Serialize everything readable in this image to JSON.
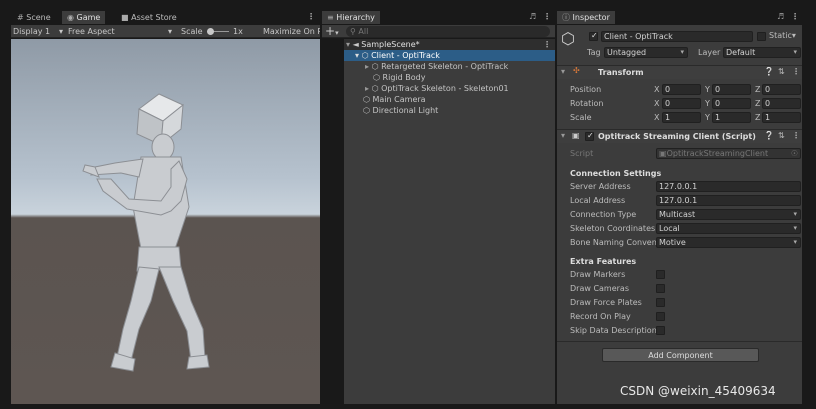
{
  "game": {
    "tabs": [
      {
        "label": "Scene",
        "icon": "hash-icon"
      },
      {
        "label": "Game",
        "icon": "gamepad-icon"
      },
      {
        "label": "Asset Store",
        "icon": "bag-icon"
      }
    ],
    "display": "Display 1",
    "aspect": "Free Aspect",
    "scale_label": "Scale",
    "scale_value": "1x",
    "maximize": "Maximize On P"
  },
  "hierarchy": {
    "title": "Hierarchy",
    "search_placeholder": "All",
    "scene_name": "SampleScene*",
    "items": [
      {
        "label": "Client - OptiTrack",
        "selected": true
      },
      {
        "label": "Retargeted Skeleton - OptiTrack"
      },
      {
        "label": "Rigid Body"
      },
      {
        "label": "OptiTrack Skeleton - Skeleton01"
      },
      {
        "label": "Main Camera"
      },
      {
        "label": "Directional Light"
      }
    ]
  },
  "inspector": {
    "title": "Inspector",
    "object_name": "Client - OptiTrack",
    "static_label": "Static",
    "tag_label": "Tag",
    "tag_value": "Untagged",
    "layer_label": "Layer",
    "layer_value": "Default",
    "transform": {
      "title": "Transform",
      "rows": [
        {
          "label": "Position",
          "x": "0",
          "y": "0",
          "z": "0"
        },
        {
          "label": "Rotation",
          "x": "0",
          "y": "0",
          "z": "0"
        },
        {
          "label": "Scale",
          "x": "1",
          "y": "1",
          "z": "1"
        }
      ],
      "axes": [
        "X",
        "Y",
        "Z"
      ]
    },
    "component": {
      "title": "Optitrack Streaming Client (Script)",
      "script_label": "Script",
      "script_value": "OptitrackStreamingClient",
      "connection_header": "Connection Settings",
      "fields": [
        {
          "label": "Server Address",
          "value": "127.0.0.1"
        },
        {
          "label": "Local Address",
          "value": "127.0.0.1"
        },
        {
          "label": "Connection Type",
          "value": "Multicast"
        },
        {
          "label": "Skeleton Coordinates",
          "value": "Local"
        },
        {
          "label": "Bone Naming Conven",
          "value": "Motive"
        }
      ],
      "extra_header": "Extra Features",
      "features": [
        {
          "label": "Draw Markers"
        },
        {
          "label": "Draw Cameras"
        },
        {
          "label": "Draw Force Plates"
        },
        {
          "label": "Record On Play"
        },
        {
          "label": "Skip Data Description"
        }
      ]
    },
    "add_component": "Add Component"
  },
  "watermark": "CSDN @weixin_45409634"
}
